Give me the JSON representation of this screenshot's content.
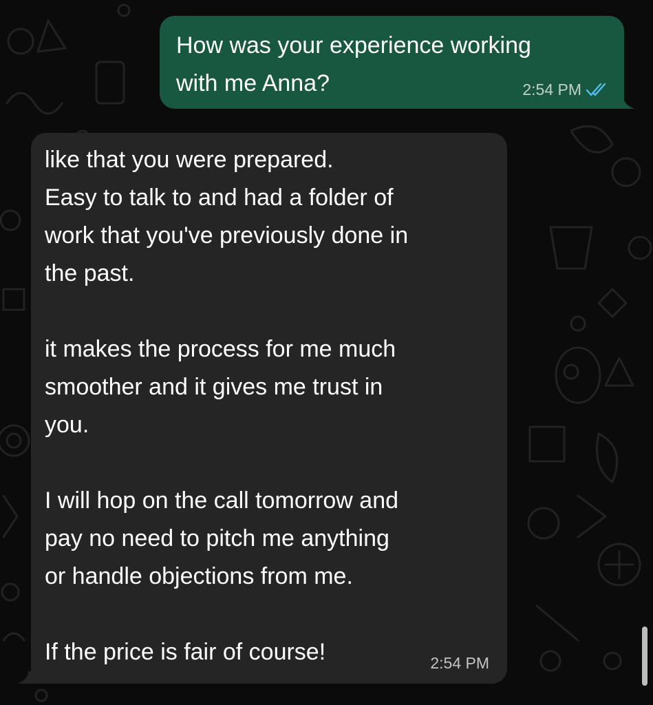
{
  "colors": {
    "background": "#0b0b0b",
    "outgoing_bubble": "#195840",
    "incoming_bubble": "#252525",
    "read_ticks": "#53bdeb",
    "timestamp_text": "#b5b5b5"
  },
  "messages": [
    {
      "direction": "outgoing",
      "text": "How was your experience working\nwith me Anna?",
      "time": "2:54 PM",
      "status_icon": "double-check-read-icon"
    },
    {
      "direction": "incoming",
      "text": "like that you were prepared.\nEasy to talk to and had a folder of\nwork that you've previously done in\nthe past.\n\nit makes the process for me much\nsmoother and it gives me trust in\nyou.\n\nI will hop on the call tomorrow and\npay no need to pitch me anything\nor handle objections from me.\n\nIf the price is fair of course!",
      "time": "2:54 PM"
    }
  ]
}
